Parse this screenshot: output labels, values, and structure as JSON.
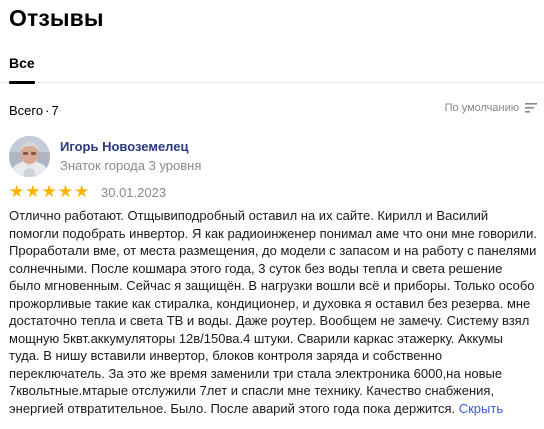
{
  "header": {
    "title": "Отзывы"
  },
  "tabs": [
    {
      "label": "Все"
    }
  ],
  "reviews_summary": {
    "label": "Всего",
    "separator": "·",
    "count": "7"
  },
  "sort": {
    "label": "По умолчанию",
    "icon": "sort-lines-icon"
  },
  "review": {
    "author": {
      "name": "Игорь Новоземелец",
      "level": "Знаток города 3 уровня",
      "avatar_icon": "user-photo"
    },
    "rating": {
      "value": 5,
      "max": 5,
      "star_color": "#fcb400"
    },
    "date": "30.01.2023",
    "text": "Отлично работают. Отщывиподробный оставил на их сайте. Кирилл и Василий помогли подобрать инвертор. Я как радиоинженер понимал аме что они мне говорили. Проработали вме, от места размещения, до модели с запасом и на работу с панелями солнечными. После кошмара этого года, 3 суток без воды тепла и света решение было мгновенным. Сейчас я защищён. В нагрузки вошли всё и приборы. Только особо прожорливые такие как стиралка, кондиционер, и духовка я оставил без резерва. мне достаточно тепла и света ТВ и воды. Даже роутер. Вообщем не замечу. Систему взял мощную 5квт.аккумуляторы 12в/150ва.4 штуки. Сварили каркас этажерку. Аккумы туда. В нишу вставили инвертор, блоков контроля заряда и собственно переключатель. За это же время заменили три стала электроника 6000,на новые 7квольтные.мтарые отслужили 7лет и спасли мне технику. Качество снабжения, энергией отвратительное. Было. После аварий этого года пока держится.",
    "collapse_label": "Скрыть"
  },
  "colors": {
    "link": "#3b5bdb",
    "author": "#2b3a7a",
    "muted": "#8a8a8a",
    "divider": "#e6e6e6"
  }
}
